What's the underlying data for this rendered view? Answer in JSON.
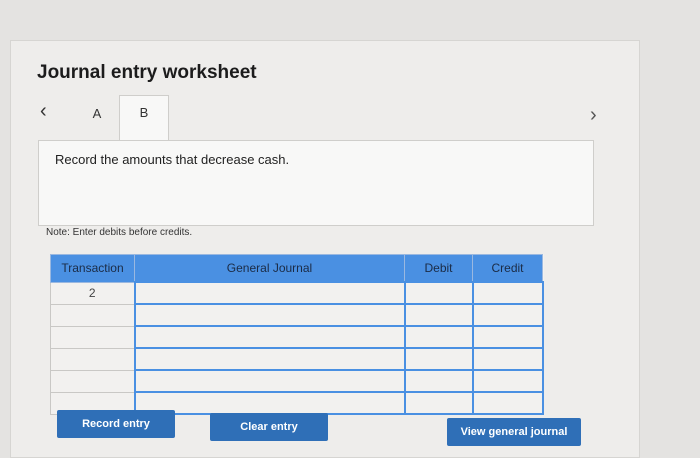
{
  "worksheet": {
    "title": "Journal entry worksheet",
    "tabs": [
      {
        "label": "A"
      },
      {
        "label": "B"
      }
    ],
    "instruction": "Record the amounts that decrease cash.",
    "note": "Note: Enter debits before credits."
  },
  "table": {
    "headers": {
      "transaction": "Transaction",
      "account": "General Journal",
      "debit": "Debit",
      "credit": "Credit"
    },
    "rows": [
      {
        "transaction": "2",
        "account": "",
        "debit": "",
        "credit": ""
      },
      {
        "transaction": "",
        "account": "",
        "debit": "",
        "credit": ""
      },
      {
        "transaction": "",
        "account": "",
        "debit": "",
        "credit": ""
      },
      {
        "transaction": "",
        "account": "",
        "debit": "",
        "credit": ""
      },
      {
        "transaction": "",
        "account": "",
        "debit": "",
        "credit": ""
      },
      {
        "transaction": "",
        "account": "",
        "debit": "",
        "credit": ""
      }
    ]
  },
  "buttons": {
    "record": "Record entry",
    "clear": "Clear entry",
    "view_journal": "View general journal"
  },
  "colors": {
    "accent": "#4a90e2",
    "button": "#2f6fb7"
  }
}
